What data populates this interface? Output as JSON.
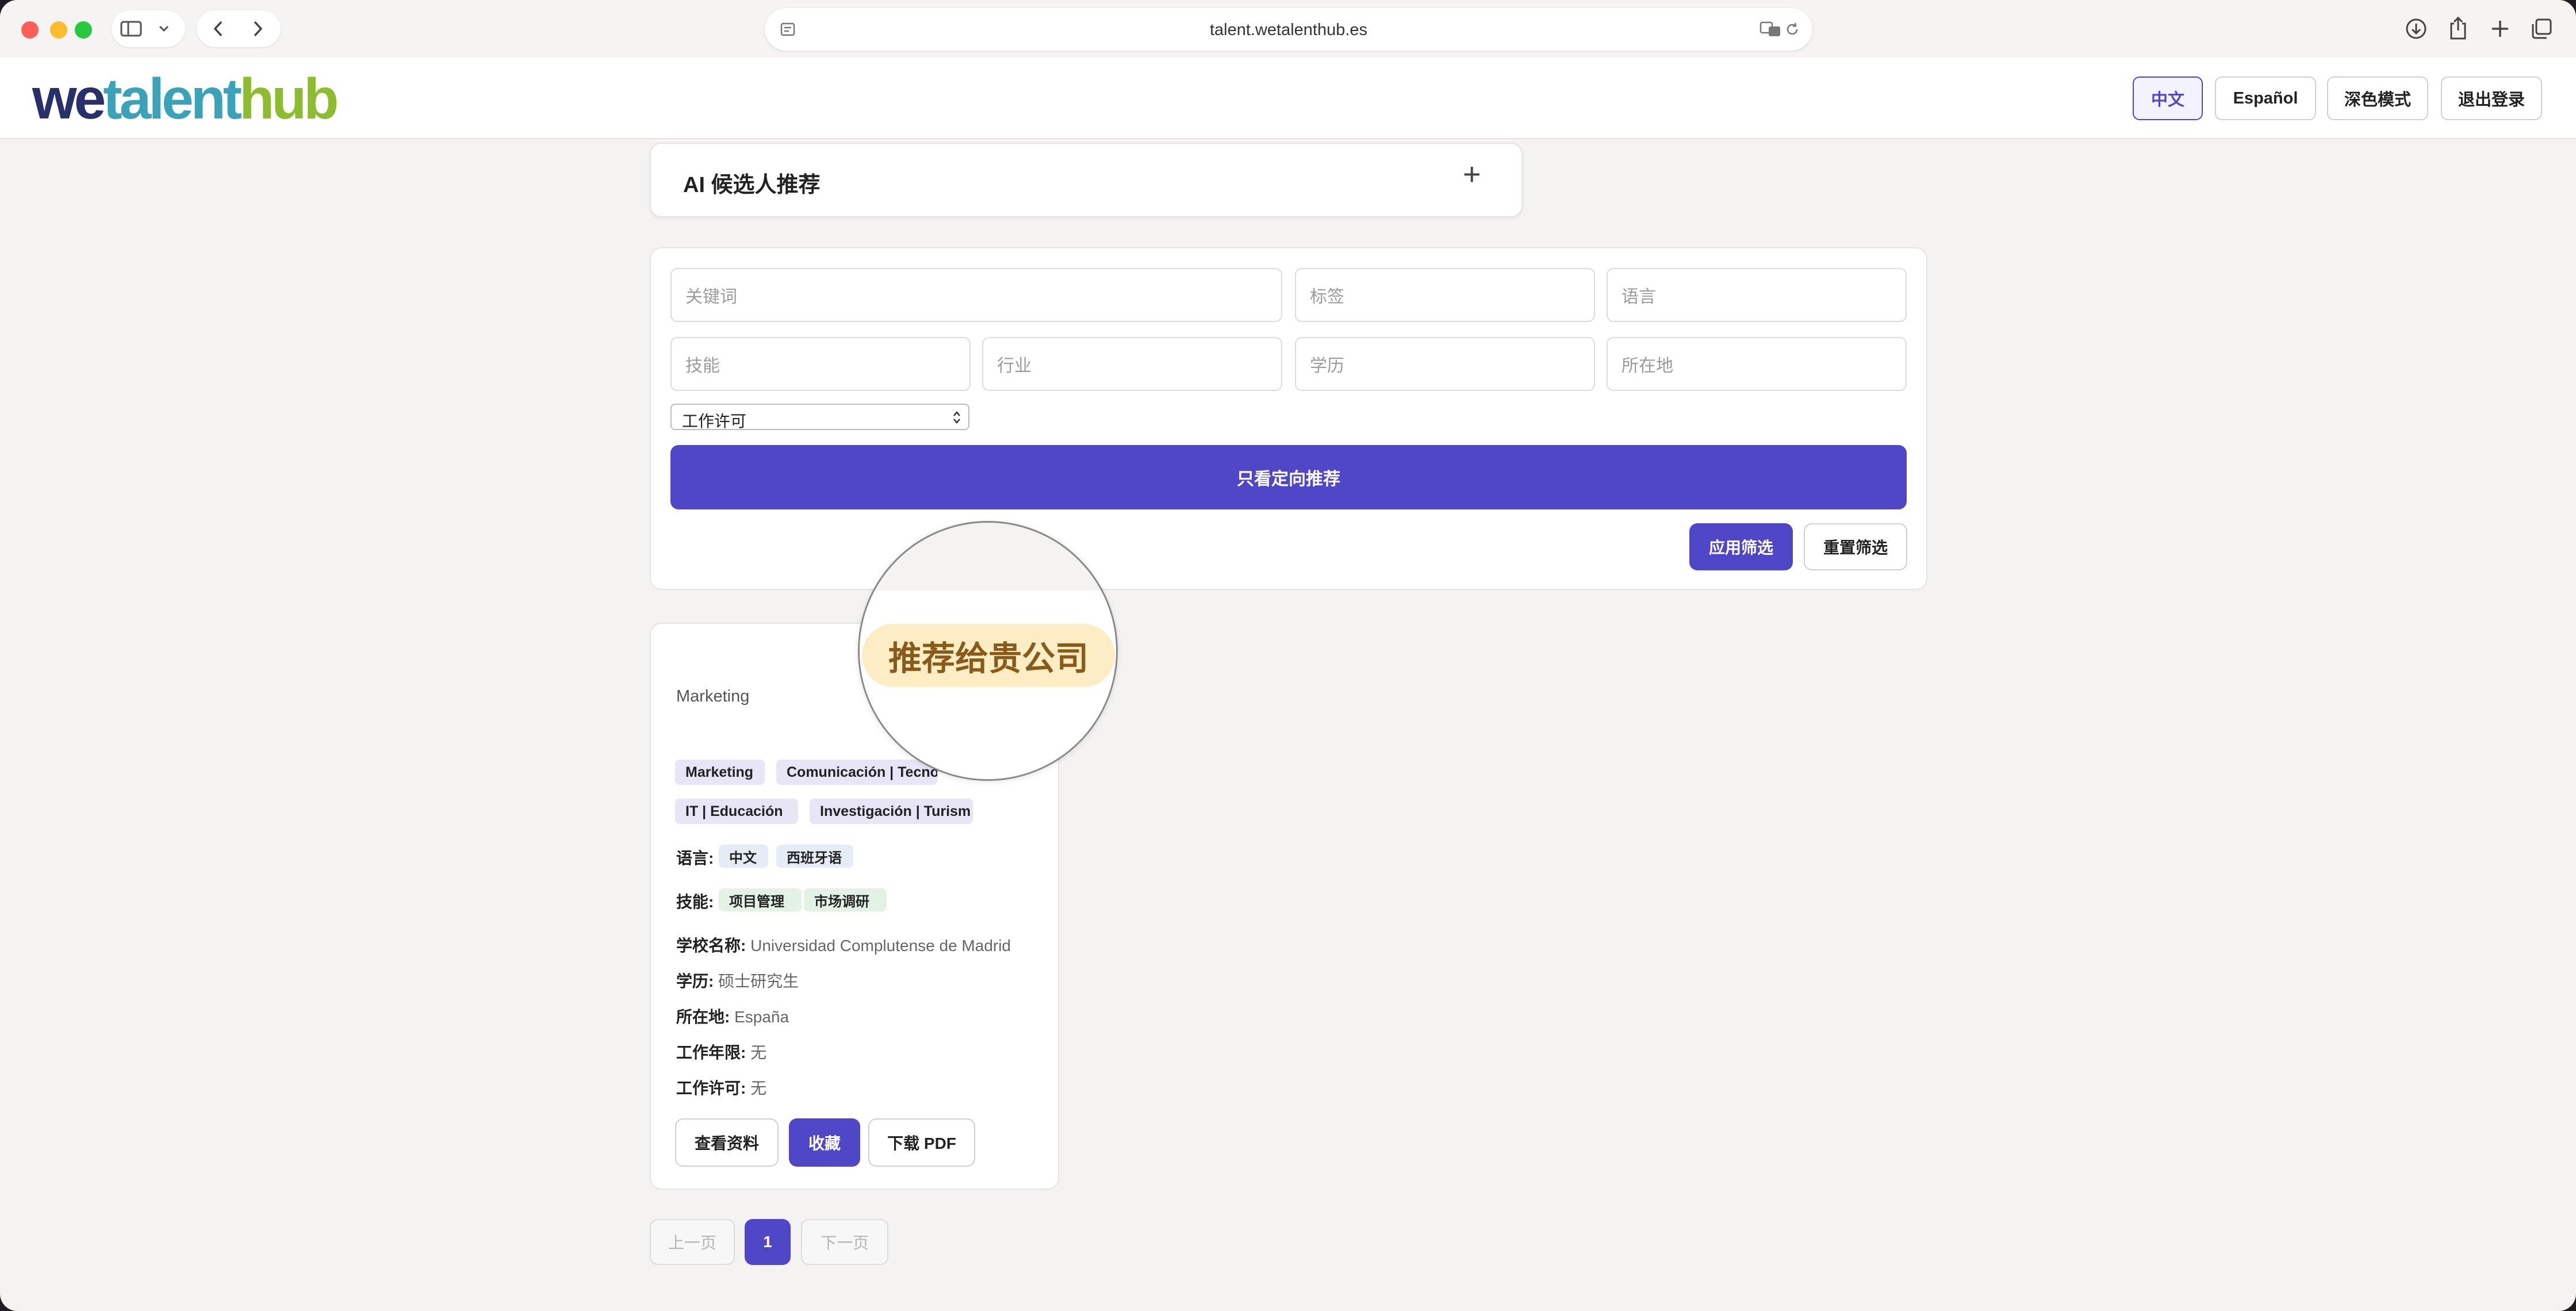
{
  "browser": {
    "url": "talent.wetalenthub.es"
  },
  "header": {
    "logo": {
      "we": "we",
      "talent": "talent",
      "hub": "hub"
    },
    "buttons": {
      "zh": "中文",
      "es": "Español",
      "dark": "深色模式",
      "logout": "退出登录"
    }
  },
  "ai_panel": {
    "title": "AI 候选人推荐",
    "expand": "+"
  },
  "filters": {
    "keyword_placeholder": "关键词",
    "tags_placeholder": "标签",
    "language_placeholder": "语言",
    "skills_placeholder": "技能",
    "industry_placeholder": "行业",
    "education_placeholder": "学历",
    "location_placeholder": "所在地",
    "work_permit_selected": "工作许可",
    "only_directed_button": "只看定向推荐",
    "apply_button": "应用筛选",
    "reset_button": "重置筛选"
  },
  "candidate": {
    "badge": "推荐给贵公司",
    "role": "Marketing",
    "industry_tags": [
      "Marketing",
      "Comunicación | Tecno",
      "IT | Educación",
      "Investigación | Turism"
    ],
    "languages_label": "语言:",
    "languages": [
      "中文",
      "西班牙语"
    ],
    "skills_label": "技能:",
    "skills": [
      "项目管理",
      "市场调研"
    ],
    "school_label": "学校名称:",
    "school": "Universidad Complutense de Madrid",
    "education_label": "学历:",
    "education": "硕士研究生",
    "location_label": "所在地:",
    "location": "España",
    "experience_label": "工作年限:",
    "experience": "无",
    "permit_label": "工作许可:",
    "permit": "无",
    "actions": {
      "view": "查看资料",
      "favorite": "收藏",
      "pdf": "下载 PDF"
    }
  },
  "pagination": {
    "prev": "上一页",
    "current": "1",
    "next": "下一页"
  },
  "colors": {
    "primary": "#5046c8",
    "badge_bg": "#fdedc5",
    "badge_text": "#8a5a19"
  }
}
